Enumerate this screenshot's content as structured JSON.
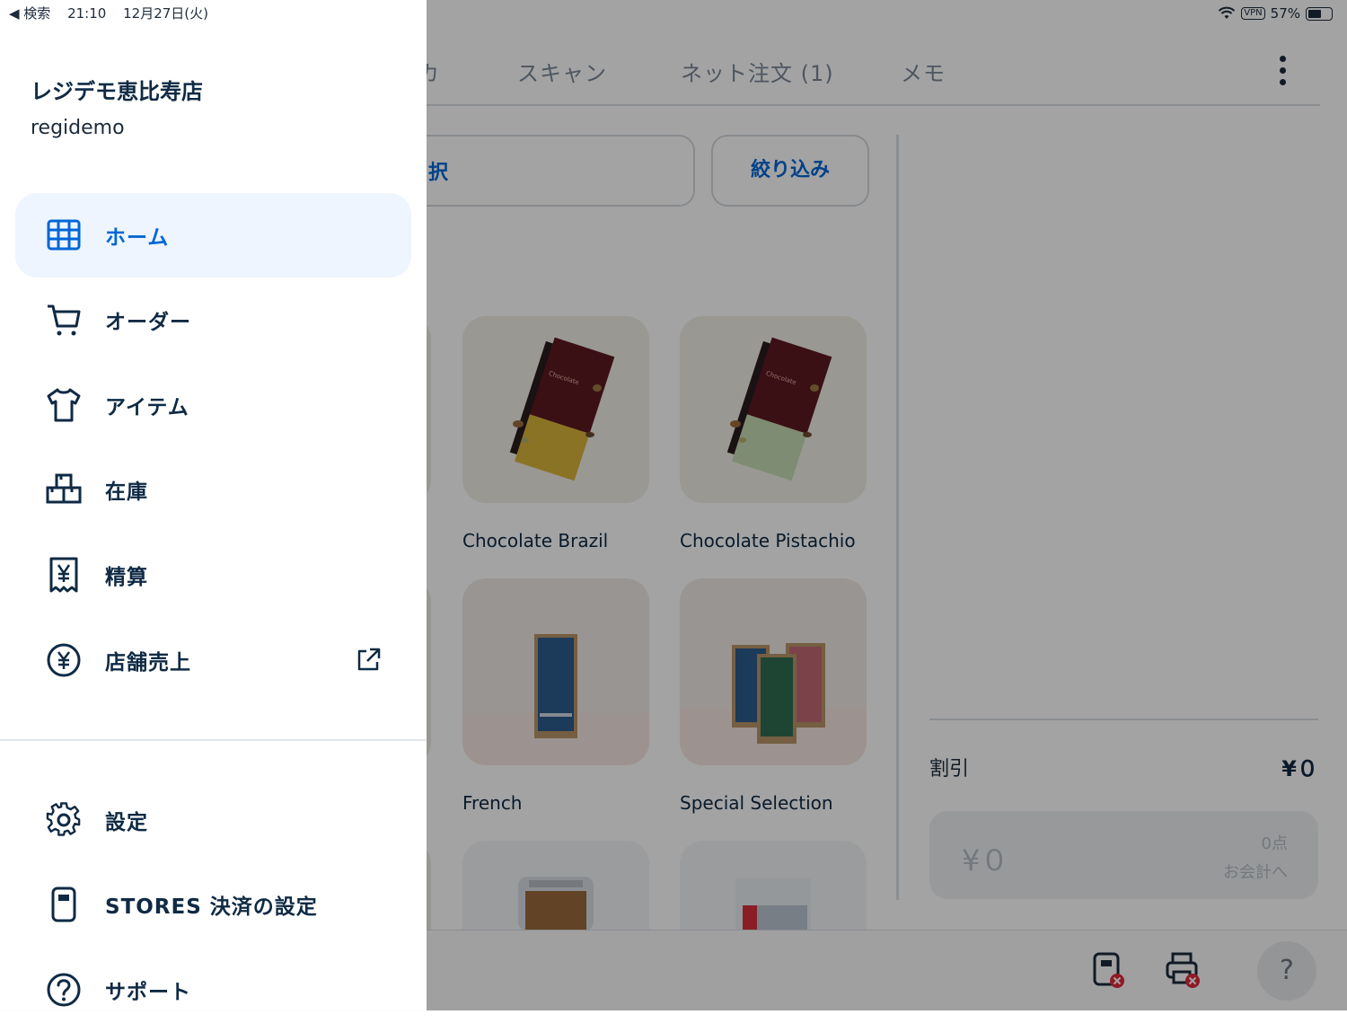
{
  "status_bar": {
    "back_label": "◀ 検索",
    "time": "21:10",
    "date": "12月27日(火)",
    "vpn": "VPN",
    "battery": "57%",
    "battery_level": 0.57
  },
  "tabs": [
    {
      "label": "カ"
    },
    {
      "label": "スキャン"
    },
    {
      "label": "ネット注文 (1)"
    },
    {
      "label": "メモ"
    }
  ],
  "toolbar": {
    "category_select_label": "択",
    "filter_label": "絞り込み"
  },
  "products": [
    {
      "name": "Chocolate Brazil",
      "image": "chocolate-bar-yellow"
    },
    {
      "name": "Chocolate Pistachio",
      "image": "chocolate-bar-green"
    },
    {
      "name": "French",
      "image": "coffee-bag-blue"
    },
    {
      "name": "Special Selection",
      "image": "coffee-bags-trio"
    },
    {
      "name": "",
      "image": "granola-jar"
    },
    {
      "name": "",
      "image": "coffee-bag-white-red"
    }
  ],
  "cart": {
    "discount_label": "割引",
    "discount_value": "¥０",
    "total": "¥０",
    "count": "0点",
    "checkout_label": "お会計へ"
  },
  "help_label": "?",
  "drawer": {
    "store_name": "レジデモ恵比寿店",
    "store_id": "regidemo",
    "menu": [
      {
        "label": "ホーム",
        "icon": "grid-icon",
        "active": true
      },
      {
        "label": "オーダー",
        "icon": "cart-icon"
      },
      {
        "label": "アイテム",
        "icon": "tshirt-icon"
      },
      {
        "label": "在庫",
        "icon": "inventory-icon"
      },
      {
        "label": "精算",
        "icon": "receipt-yen-icon"
      },
      {
        "label": "店舗売上",
        "icon": "yen-circle-icon",
        "external": true
      }
    ],
    "bottom_menu": [
      {
        "label": "設定",
        "icon": "gear-icon"
      },
      {
        "label": "STORES 決済の設定",
        "icon": "card-reader-icon"
      },
      {
        "label": "サポート",
        "icon": "question-circle-icon"
      }
    ]
  },
  "colors": {
    "accent": "#0066d6",
    "text": "#0f2a44",
    "active_bg": "#eef5fe",
    "error": "#e0283a"
  }
}
